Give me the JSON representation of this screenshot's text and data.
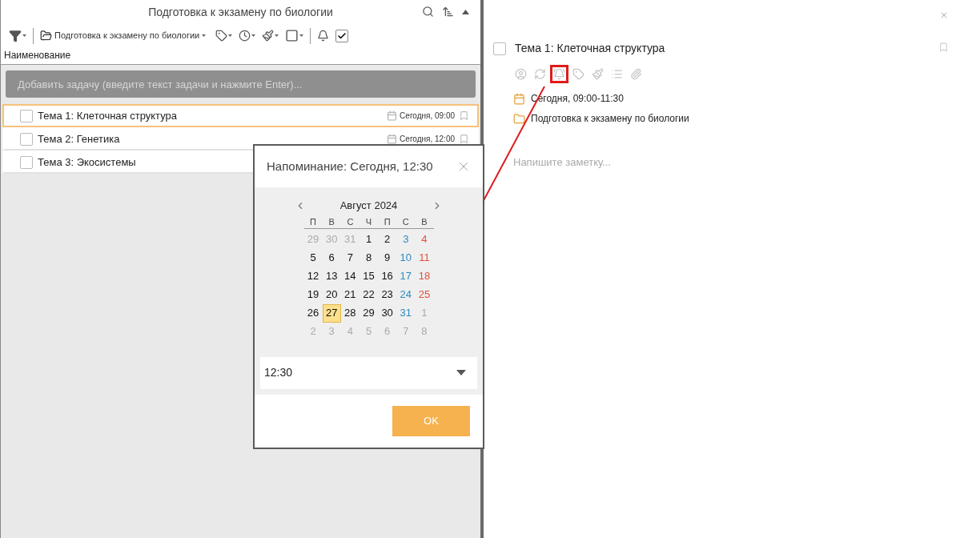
{
  "list_panel": {
    "title": "Подготовка к экзамену по биологии",
    "toolbar": {
      "project_filter": "Подготовка к экзамену по биологии",
      "show_completed": true
    },
    "column_header": "Наименование",
    "add_task": {
      "placeholder": "Добавить задачу (введите текст задачи и нажмите Enter)..."
    },
    "tasks": [
      {
        "title": "Тема 1: Клеточная структура",
        "due": "Сегодня, 09:00",
        "checked": false,
        "selected": true
      },
      {
        "title": "Тема 2: Генетика",
        "due": "Сегодня, 12:00",
        "checked": false,
        "selected": false
      },
      {
        "title": "Тема 3: Экосистемы",
        "checked": false,
        "selected": false
      }
    ]
  },
  "detail_panel": {
    "task": {
      "title": "Тема 1: Клеточная структура",
      "checked": false
    },
    "tools": [
      {
        "kind": "assignee",
        "highlighted": false
      },
      {
        "kind": "repeat",
        "highlighted": false
      },
      {
        "kind": "reminder",
        "highlighted": true
      },
      {
        "kind": "tag",
        "highlighted": false
      },
      {
        "kind": "color",
        "highlighted": false
      },
      {
        "kind": "checklist",
        "highlighted": false
      },
      {
        "kind": "attachment",
        "highlighted": false
      }
    ],
    "schedule": "Сегодня, 09:00-11:30",
    "project": "Подготовка к экзамену по биологии",
    "note": {
      "placeholder": "Напишите заметку..."
    }
  },
  "reminder_dialog": {
    "title": "Напоминание: Сегодня, 12:30",
    "month": "Август 2024",
    "weekdays": [
      "П",
      "В",
      "С",
      "Ч",
      "П",
      "С",
      "В"
    ],
    "weeks": [
      [
        {
          "day": "29",
          "kind": "outside",
          "selected": false
        },
        {
          "day": "30",
          "kind": "outside",
          "selected": false
        },
        {
          "day": "31",
          "kind": "outside",
          "selected": false
        },
        {
          "day": "1",
          "kind": "weekday",
          "selected": false
        },
        {
          "day": "2",
          "kind": "weekday",
          "selected": false
        },
        {
          "day": "3",
          "kind": "saturday",
          "selected": false
        },
        {
          "day": "4",
          "kind": "sunday",
          "selected": false
        }
      ],
      [
        {
          "day": "5",
          "kind": "weekday",
          "selected": false
        },
        {
          "day": "6",
          "kind": "weekday",
          "selected": false
        },
        {
          "day": "7",
          "kind": "weekday",
          "selected": false
        },
        {
          "day": "8",
          "kind": "weekday",
          "selected": false
        },
        {
          "day": "9",
          "kind": "weekday",
          "selected": false
        },
        {
          "day": "10",
          "kind": "saturday",
          "selected": false
        },
        {
          "day": "11",
          "kind": "sunday",
          "selected": false
        }
      ],
      [
        {
          "day": "12",
          "kind": "weekday",
          "selected": false
        },
        {
          "day": "13",
          "kind": "weekday",
          "selected": false
        },
        {
          "day": "14",
          "kind": "weekday",
          "selected": false
        },
        {
          "day": "15",
          "kind": "weekday",
          "selected": false
        },
        {
          "day": "16",
          "kind": "weekday",
          "selected": false
        },
        {
          "day": "17",
          "kind": "saturday",
          "selected": false
        },
        {
          "day": "18",
          "kind": "sunday",
          "selected": false
        }
      ],
      [
        {
          "day": "19",
          "kind": "weekday",
          "selected": false
        },
        {
          "day": "20",
          "kind": "weekday",
          "selected": false
        },
        {
          "day": "21",
          "kind": "weekday",
          "selected": false
        },
        {
          "day": "22",
          "kind": "weekday",
          "selected": false
        },
        {
          "day": "23",
          "kind": "weekday",
          "selected": false
        },
        {
          "day": "24",
          "kind": "saturday",
          "selected": false
        },
        {
          "day": "25",
          "kind": "sunday",
          "selected": false
        }
      ],
      [
        {
          "day": "26",
          "kind": "weekday",
          "selected": false
        },
        {
          "day": "27",
          "kind": "weekday",
          "selected": true
        },
        {
          "day": "28",
          "kind": "weekday",
          "selected": false
        },
        {
          "day": "29",
          "kind": "weekday",
          "selected": false
        },
        {
          "day": "30",
          "kind": "weekday",
          "selected": false
        },
        {
          "day": "31",
          "kind": "saturday",
          "selected": false
        },
        {
          "day": "1",
          "kind": "outside",
          "selected": false
        }
      ],
      [
        {
          "day": "2",
          "kind": "outside",
          "selected": false
        },
        {
          "day": "3",
          "kind": "outside",
          "selected": false
        },
        {
          "day": "4",
          "kind": "outside",
          "selected": false
        },
        {
          "day": "5",
          "kind": "outside",
          "selected": false
        },
        {
          "day": "6",
          "kind": "outside",
          "selected": false
        },
        {
          "day": "7",
          "kind": "outside",
          "selected": false
        },
        {
          "day": "8",
          "kind": "outside",
          "selected": false
        }
      ]
    ],
    "time": "12:30",
    "ok_button": "OK"
  }
}
